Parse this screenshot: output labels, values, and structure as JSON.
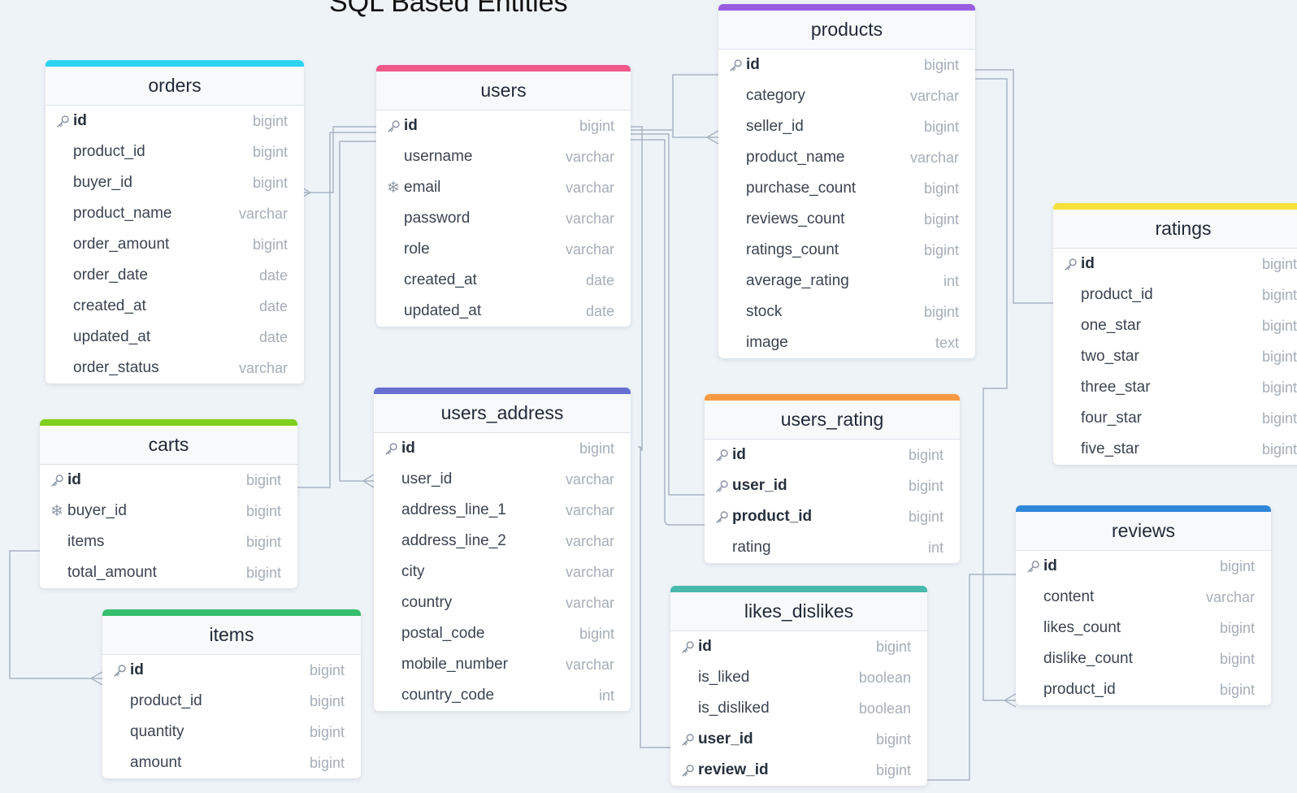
{
  "title": "SQL Based Entities",
  "tables": [
    {
      "key": "orders",
      "name": "orders",
      "accent": "#2ed3f0",
      "columns": [
        {
          "name": "id",
          "type": "bigint",
          "icon": "key-icon",
          "style": "pk"
        },
        {
          "name": "product_id",
          "type": "bigint",
          "icon": "",
          "style": ""
        },
        {
          "name": "buyer_id",
          "type": "bigint",
          "icon": "",
          "style": ""
        },
        {
          "name": "product_name",
          "type": "varchar",
          "icon": "",
          "style": ""
        },
        {
          "name": "order_amount",
          "type": "bigint",
          "icon": "",
          "style": ""
        },
        {
          "name": "order_date",
          "type": "date",
          "icon": "",
          "style": ""
        },
        {
          "name": "created_at",
          "type": "date",
          "icon": "",
          "style": ""
        },
        {
          "name": "updated_at",
          "type": "date",
          "icon": "",
          "style": ""
        },
        {
          "name": "order_status",
          "type": "varchar",
          "icon": "",
          "style": ""
        }
      ]
    },
    {
      "key": "users",
      "name": "users",
      "accent": "#f0598a",
      "columns": [
        {
          "name": "id",
          "type": "bigint",
          "icon": "key-icon",
          "style": "pk"
        },
        {
          "name": "username",
          "type": "varchar",
          "icon": "",
          "style": ""
        },
        {
          "name": "email",
          "type": "varchar",
          "icon": "snowflake-icon",
          "style": ""
        },
        {
          "name": "password",
          "type": "varchar",
          "icon": "",
          "style": ""
        },
        {
          "name": "role",
          "type": "varchar",
          "icon": "",
          "style": ""
        },
        {
          "name": "created_at",
          "type": "date",
          "icon": "",
          "style": ""
        },
        {
          "name": "updated_at",
          "type": "date",
          "icon": "",
          "style": ""
        }
      ]
    },
    {
      "key": "products",
      "name": "products",
      "accent": "#9a5de0",
      "columns": [
        {
          "name": "id",
          "type": "bigint",
          "icon": "key-icon",
          "style": "pk"
        },
        {
          "name": "category",
          "type": "varchar",
          "icon": "",
          "style": ""
        },
        {
          "name": "seller_id",
          "type": "bigint",
          "icon": "",
          "style": ""
        },
        {
          "name": "product_name",
          "type": "varchar",
          "icon": "",
          "style": ""
        },
        {
          "name": "purchase_count",
          "type": "bigint",
          "icon": "",
          "style": ""
        },
        {
          "name": "reviews_count",
          "type": "bigint",
          "icon": "",
          "style": ""
        },
        {
          "name": "ratings_count",
          "type": "bigint",
          "icon": "",
          "style": ""
        },
        {
          "name": "average_rating",
          "type": "int",
          "icon": "",
          "style": ""
        },
        {
          "name": "stock",
          "type": "bigint",
          "icon": "",
          "style": ""
        },
        {
          "name": "image",
          "type": "text",
          "icon": "",
          "style": ""
        }
      ]
    },
    {
      "key": "ratings",
      "name": "ratings",
      "accent": "#f5e23b",
      "columns": [
        {
          "name": "id",
          "type": "bigint",
          "icon": "key-icon",
          "style": "pk"
        },
        {
          "name": "product_id",
          "type": "bigint",
          "icon": "",
          "style": ""
        },
        {
          "name": "one_star",
          "type": "bigint",
          "icon": "",
          "style": ""
        },
        {
          "name": "two_star",
          "type": "bigint",
          "icon": "",
          "style": ""
        },
        {
          "name": "three_star",
          "type": "bigint",
          "icon": "",
          "style": ""
        },
        {
          "name": "four_star",
          "type": "bigint",
          "icon": "",
          "style": ""
        },
        {
          "name": "five_star",
          "type": "bigint",
          "icon": "",
          "style": ""
        }
      ]
    },
    {
      "key": "carts",
      "name": "carts",
      "accent": "#7fcf1f",
      "columns": [
        {
          "name": "id",
          "type": "bigint",
          "icon": "key-icon",
          "style": "pk"
        },
        {
          "name": "buyer_id",
          "type": "bigint",
          "icon": "snowflake-icon",
          "style": ""
        },
        {
          "name": "items",
          "type": "bigint",
          "icon": "",
          "style": ""
        },
        {
          "name": "total_amount",
          "type": "bigint",
          "icon": "",
          "style": ""
        }
      ]
    },
    {
      "key": "users_address",
      "name": "users_address",
      "accent": "#6670d0",
      "columns": [
        {
          "name": "id",
          "type": "bigint",
          "icon": "key-icon",
          "style": "pk"
        },
        {
          "name": "user_id",
          "type": "varchar",
          "icon": "",
          "style": ""
        },
        {
          "name": "address_line_1",
          "type": "varchar",
          "icon": "",
          "style": ""
        },
        {
          "name": "address_line_2",
          "type": "varchar",
          "icon": "",
          "style": ""
        },
        {
          "name": "city",
          "type": "varchar",
          "icon": "",
          "style": ""
        },
        {
          "name": "country",
          "type": "varchar",
          "icon": "",
          "style": ""
        },
        {
          "name": "postal_code",
          "type": "bigint",
          "icon": "",
          "style": ""
        },
        {
          "name": "mobile_number",
          "type": "varchar",
          "icon": "",
          "style": ""
        },
        {
          "name": "country_code",
          "type": "int",
          "icon": "",
          "style": ""
        }
      ]
    },
    {
      "key": "users_rating",
      "name": "users_rating",
      "accent": "#f79a42",
      "columns": [
        {
          "name": "id",
          "type": "bigint",
          "icon": "key-icon",
          "style": "pk"
        },
        {
          "name": "user_id",
          "type": "bigint",
          "icon": "key-icon",
          "style": "fk"
        },
        {
          "name": "product_id",
          "type": "bigint",
          "icon": "key-icon",
          "style": "fk"
        },
        {
          "name": "rating",
          "type": "int",
          "icon": "",
          "style": ""
        }
      ]
    },
    {
      "key": "reviews",
      "name": "reviews",
      "accent": "#2f87d9",
      "columns": [
        {
          "name": "id",
          "type": "bigint",
          "icon": "key-icon",
          "style": "pk"
        },
        {
          "name": "content",
          "type": "varchar",
          "icon": "",
          "style": ""
        },
        {
          "name": "likes_count",
          "type": "bigint",
          "icon": "",
          "style": ""
        },
        {
          "name": "dislike_count",
          "type": "bigint",
          "icon": "",
          "style": ""
        },
        {
          "name": "product_id",
          "type": "bigint",
          "icon": "",
          "style": ""
        }
      ]
    },
    {
      "key": "items",
      "name": "items",
      "accent": "#36be6c",
      "columns": [
        {
          "name": "id",
          "type": "bigint",
          "icon": "key-icon",
          "style": "pk"
        },
        {
          "name": "product_id",
          "type": "bigint",
          "icon": "",
          "style": ""
        },
        {
          "name": "quantity",
          "type": "bigint",
          "icon": "",
          "style": ""
        },
        {
          "name": "amount",
          "type": "bigint",
          "icon": "",
          "style": ""
        }
      ]
    },
    {
      "key": "likes_dislikes",
      "name": "likes_dislikes",
      "accent": "#48b9ad",
      "columns": [
        {
          "name": "id",
          "type": "bigint",
          "icon": "key-icon",
          "style": "pk"
        },
        {
          "name": "is_liked",
          "type": "boolean",
          "icon": "",
          "style": ""
        },
        {
          "name": "is_disliked",
          "type": "boolean",
          "icon": "",
          "style": ""
        },
        {
          "name": "user_id",
          "type": "bigint",
          "icon": "key-icon",
          "style": "fk"
        },
        {
          "name": "review_id",
          "type": "bigint",
          "icon": "key-icon",
          "style": "fk"
        }
      ]
    }
  ]
}
